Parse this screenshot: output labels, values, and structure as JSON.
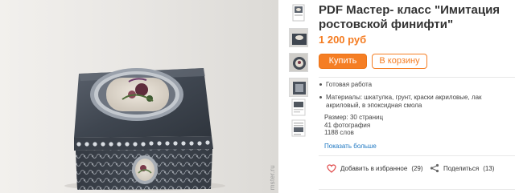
{
  "product": {
    "title": "PDF Мастер- класс \"Имитация ростовской финифти\"",
    "price": "1 200 руб",
    "buy_label": "Купить",
    "cart_label": "В корзину",
    "features": [
      "Готовая работа",
      "Материалы:  шкатулка, грунт, краски акриловые, лак акриловый, в эпоксидная смола"
    ],
    "size_line": "Размер:  30 страниц",
    "photos_line": "41 фотография",
    "words_line": "1188 слов",
    "more_link": "Показать больше",
    "favorite_label": "Добавить в избранное",
    "favorite_count": "(29)",
    "share_label": "Поделиться",
    "share_count": "(13)"
  },
  "photo": {
    "watermark": "mster.ru"
  },
  "colors": {
    "accent": "#f47b20",
    "link": "#1d77c2",
    "heart": "#e04b4b"
  },
  "icons": {
    "favorite": "heart-outline-icon",
    "share": "share-icon"
  }
}
